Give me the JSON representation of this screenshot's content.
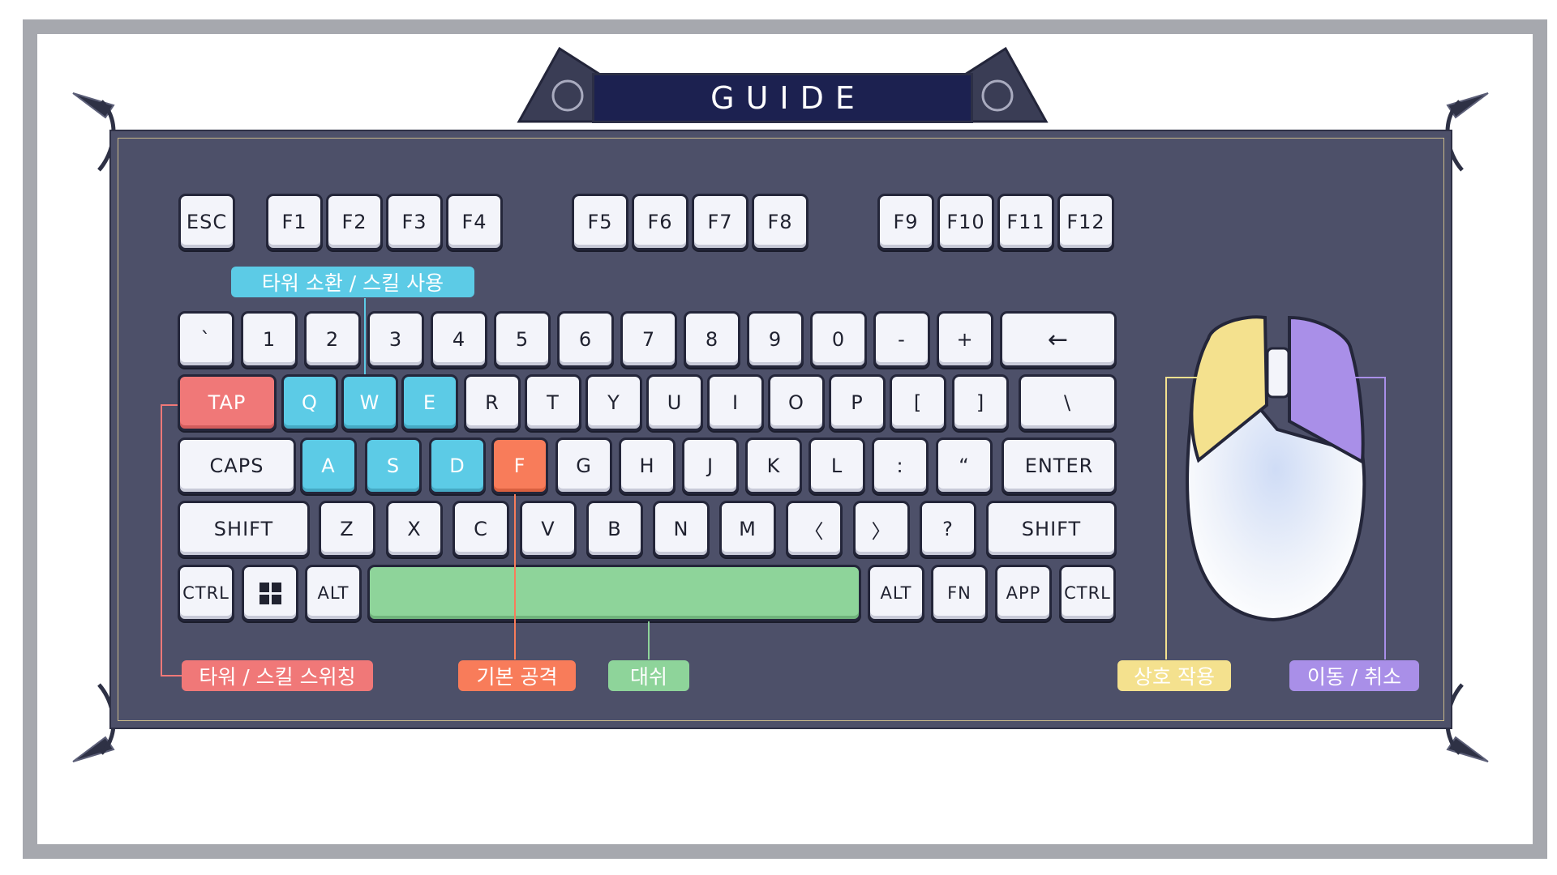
{
  "title": "GUIDE",
  "colors": {
    "blue": "#5ccbe6",
    "red": "#f07878",
    "orange": "#f87c5a",
    "green": "#8ed49a",
    "yellow": "#f4e18e",
    "purple": "#a98fe8",
    "panel": "#4d5069",
    "key": "#f3f4fa"
  },
  "keyboard": {
    "function_row": [
      "ESC",
      "F1",
      "F2",
      "F3",
      "F4",
      "F5",
      "F6",
      "F7",
      "F8",
      "F9",
      "F10",
      "F11",
      "F12"
    ],
    "number_row": [
      "`",
      "1",
      "2",
      "3",
      "4",
      "5",
      "6",
      "7",
      "8",
      "9",
      "0",
      "-",
      "+",
      "←"
    ],
    "q_row": [
      "TAP",
      "Q",
      "W",
      "E",
      "R",
      "T",
      "Y",
      "U",
      "I",
      "O",
      "P",
      "[",
      "]",
      "\\"
    ],
    "a_row": [
      "CAPS",
      "A",
      "S",
      "D",
      "F",
      "G",
      "H",
      "J",
      "K",
      "L",
      ":",
      "“",
      "ENTER"
    ],
    "z_row": [
      "SHIFT",
      "Z",
      "X",
      "C",
      "V",
      "B",
      "N",
      "M",
      "〈",
      "〉",
      "?",
      "SHIFT"
    ],
    "bottom_row": [
      "CTRL",
      "windows-icon",
      "ALT",
      "",
      "ALT",
      "FN",
      "APP",
      "CTRL"
    ]
  },
  "labels": {
    "tower_skill_use": "타워 소환 / 스킬 사용",
    "tower_skill_switch": "타워 / 스킬 스위칭",
    "basic_attack": "기본 공격",
    "dash": "대쉬",
    "interact": "상호 작용",
    "move_cancel": "이동 / 취소"
  }
}
